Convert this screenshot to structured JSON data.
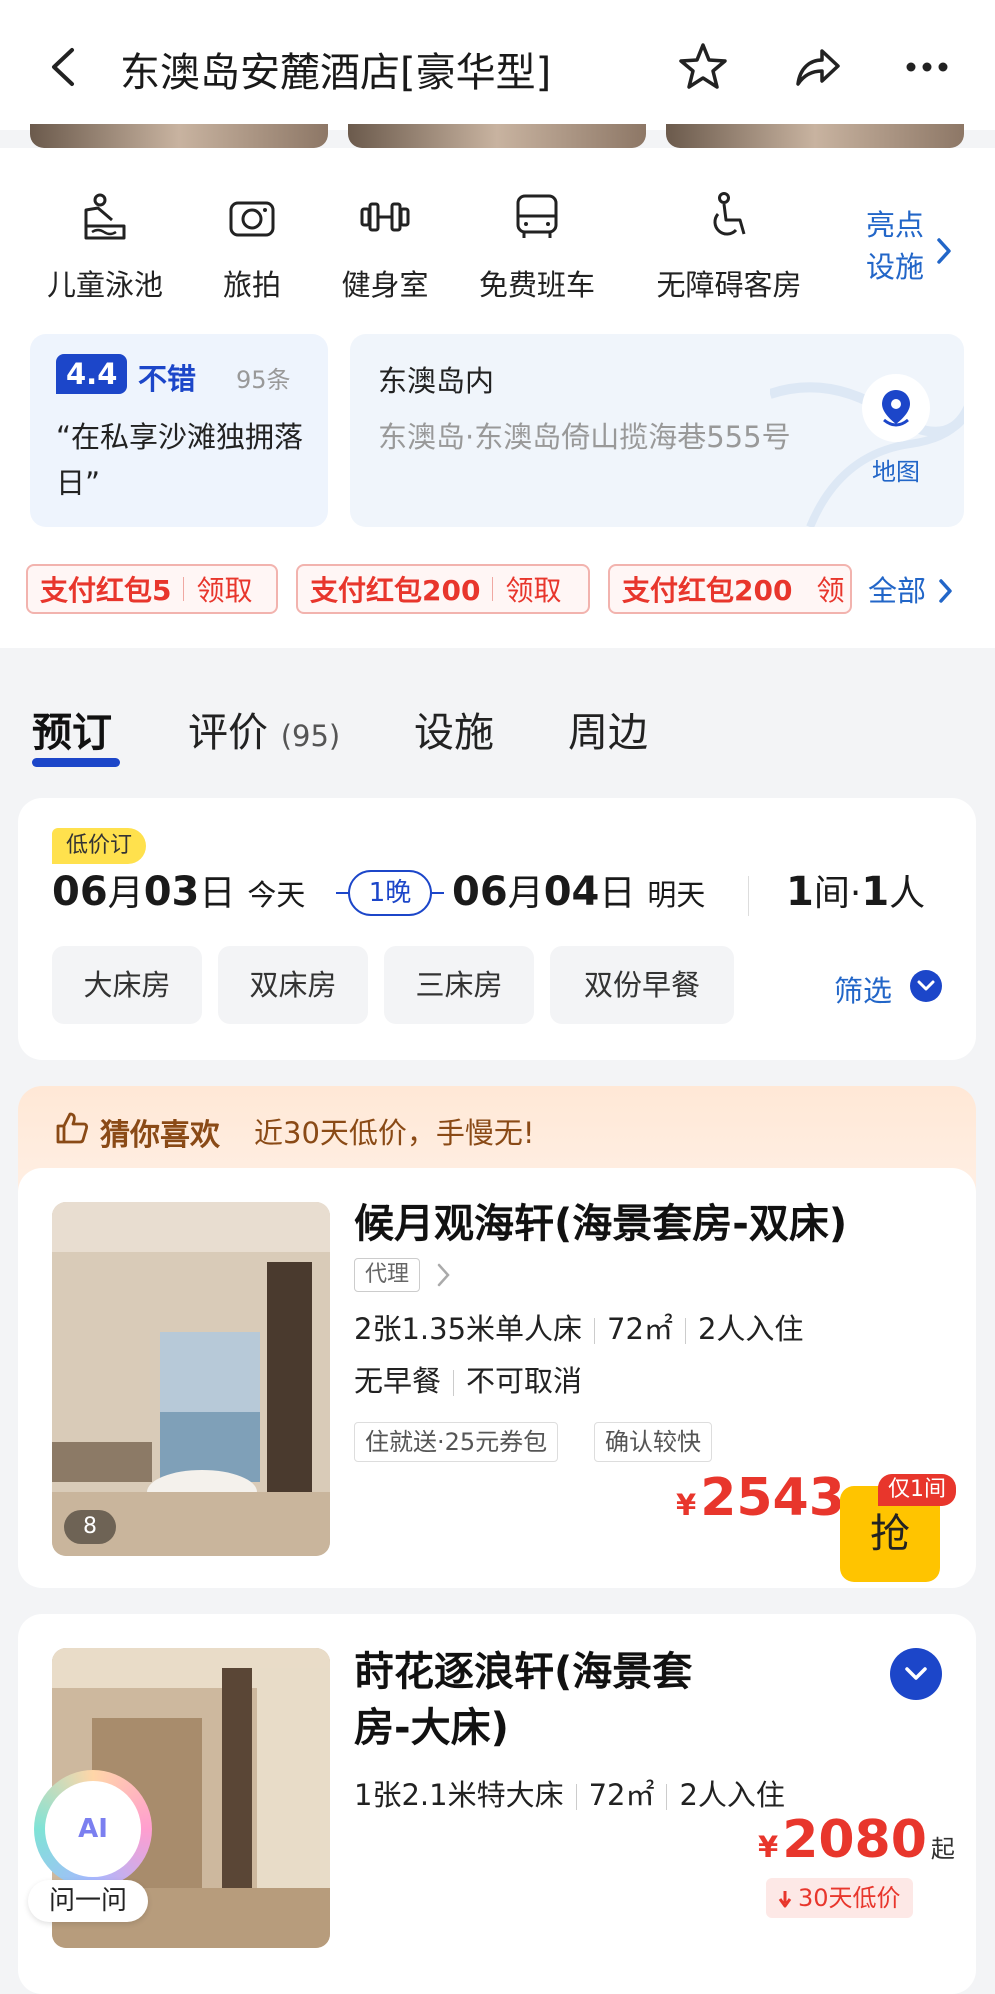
{
  "header": {
    "title": "东澳岛安麓酒店[豪华型]"
  },
  "facilities": [
    {
      "label": "儿童泳池",
      "icon": "kids-pool-icon"
    },
    {
      "label": "旅拍",
      "icon": "camera-icon"
    },
    {
      "label": "健身室",
      "icon": "dumbbell-icon"
    },
    {
      "label": "免费班车",
      "icon": "shuttle-bus-icon"
    },
    {
      "label": "无障碍客房",
      "icon": "wheelchair-icon"
    }
  ],
  "highlight": {
    "line1": "亮点",
    "line2": "设施"
  },
  "rating": {
    "score": "4.4",
    "text": "不错",
    "count": "95条",
    "quote": "“在私享沙滩独拥落日”"
  },
  "location": {
    "title": "东澳岛内",
    "address": "东澳岛·东澳岛倚山揽海巷555号",
    "map_label": "地图"
  },
  "coupons": [
    {
      "label": "支付红包5",
      "action": "领取"
    },
    {
      "label": "支付红包200",
      "action": "领取"
    },
    {
      "label": "支付红包200",
      "action": "领"
    }
  ],
  "coupons_all": "全部",
  "tabs": [
    {
      "label": "预订"
    },
    {
      "label": "评价",
      "count": "(95)"
    },
    {
      "label": "设施"
    },
    {
      "label": "周边"
    }
  ],
  "booking": {
    "tag": "低价订",
    "checkin_month": "06",
    "checkin_day": "03",
    "checkin_rel": "今天",
    "nights": "1晚",
    "checkout_month": "06",
    "checkout_day": "04",
    "checkout_rel": "明天",
    "rooms": "1",
    "persons": "1",
    "month_unit": "月",
    "day_unit": "日",
    "room_unit": "间",
    "person_unit": "人",
    "dot": "·"
  },
  "filters": [
    "大床房",
    "双床房",
    "三床房",
    "双份早餐"
  ],
  "filter_label": "筛选",
  "recommend": {
    "title": "猜你喜欢",
    "subtitle": "近30天低价，手慢无!"
  },
  "rooms": [
    {
      "name": "候月观海轩(海景套房-双床)",
      "agent": "代理",
      "bed": "2张1.35米单人床",
      "area": "72㎡",
      "guests": "2人入住",
      "breakfast": "无早餐",
      "cancel": "不可取消",
      "perks": [
        "住就送·25元券包",
        "确认较快"
      ],
      "currency": "¥",
      "price": "2543",
      "only": "仅1间",
      "button": "抢",
      "image_count": "8"
    },
    {
      "name_line1": "莳花逐浪轩(海景套",
      "name_line2": "房-大床)",
      "bed": "1张2.1米特大床",
      "area": "72㎡",
      "guests": "2人入住",
      "currency": "¥",
      "price": "2080",
      "price_suffix": "起",
      "low_tag": "30天低价"
    }
  ],
  "ask": {
    "label": "问一问",
    "badge": "AI"
  },
  "colors": {
    "brand_blue": "#1c46c9",
    "link_blue": "#2266c8",
    "price_red": "#e8362c",
    "grab_yellow": "#ffc400"
  }
}
